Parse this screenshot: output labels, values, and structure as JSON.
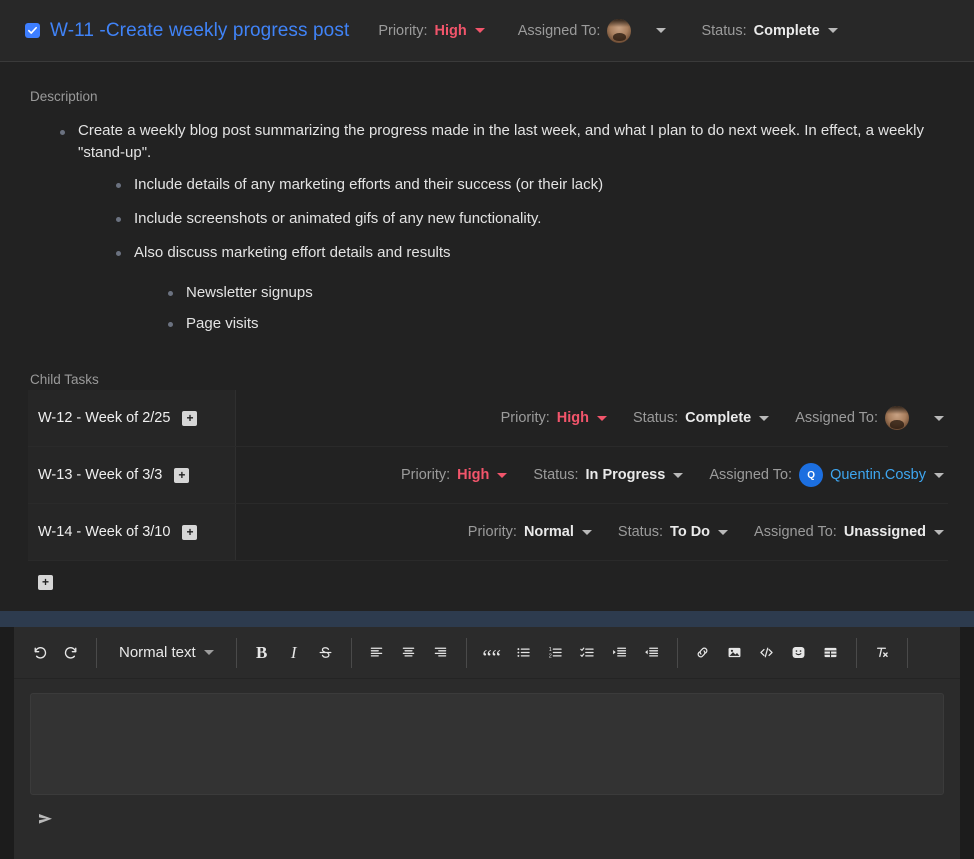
{
  "header": {
    "checkbox_checked": true,
    "title": "W-11 -Create weekly progress post",
    "priority_label": "Priority:",
    "priority_value": "High",
    "assigned_label": "Assigned To:",
    "assigned_value": "",
    "status_label": "Status:",
    "status_value": "Complete",
    "title_color": "#4083f7",
    "high_color": "#f2556b"
  },
  "description": {
    "section_label": "Description",
    "bullets": [
      {
        "text": "Create a weekly blog post summarizing the progress made in the last week, and what I plan to do next week. In effect, a weekly \"stand-up\".",
        "children": [
          {
            "text": "Include details of any marketing efforts and their success (or their lack)"
          },
          {
            "text": "Include screenshots or animated gifs of any new functionality."
          },
          {
            "text": "Also discuss marketing effort details and results",
            "children": [
              {
                "text": "Newsletter signups"
              },
              {
                "text": "Page visits"
              }
            ]
          }
        ]
      }
    ]
  },
  "child_tasks": {
    "section_label": "Child Tasks",
    "add_button_label": "+",
    "rows": [
      {
        "key": "W-12 - Week of 2/25",
        "expand_label": "+",
        "priority_label": "Priority:",
        "priority_value": "High",
        "status_label": "Status:",
        "status_value": "Complete",
        "assigned_label": "Assigned To:",
        "assigned_value": "",
        "assignee_type": "photo"
      },
      {
        "key": "W-13 - Week of 3/3",
        "expand_label": "+",
        "priority_label": "Priority:",
        "priority_value": "High",
        "status_label": "Status:",
        "status_value": "In Progress",
        "assigned_label": "Assigned To:",
        "assigned_value": "Quentin.Cosby",
        "assignee_type": "initial",
        "assignee_initial": "Q"
      },
      {
        "key": "W-14 - Week of 3/10",
        "expand_label": "+",
        "priority_label": "Priority:",
        "priority_value": "Normal",
        "status_label": "Status:",
        "status_value": "To Do",
        "assigned_label": "Assigned To:",
        "assigned_value": "Unassigned",
        "assignee_type": "none"
      }
    ]
  },
  "editor": {
    "style_value": "Normal text",
    "content": "",
    "toolbar_icons": [
      "undo-icon",
      "redo-icon",
      "bold-icon",
      "italic-icon",
      "strikethrough-icon",
      "align-left-icon",
      "align-center-icon",
      "align-right-icon",
      "blockquote-icon",
      "bullet-list-icon",
      "numbered-list-icon",
      "checklist-icon",
      "indent-icon",
      "outdent-icon",
      "link-icon",
      "image-icon",
      "code-icon",
      "emoji-icon",
      "table-icon",
      "clear-formatting-icon"
    ],
    "send_icon": "send-icon"
  },
  "colors": {
    "accent_blue": "#4083f7",
    "high_red": "#f2556b",
    "panel_bg": "#222222",
    "header_bg": "#282828",
    "band_blue": "#2d3b4e"
  }
}
